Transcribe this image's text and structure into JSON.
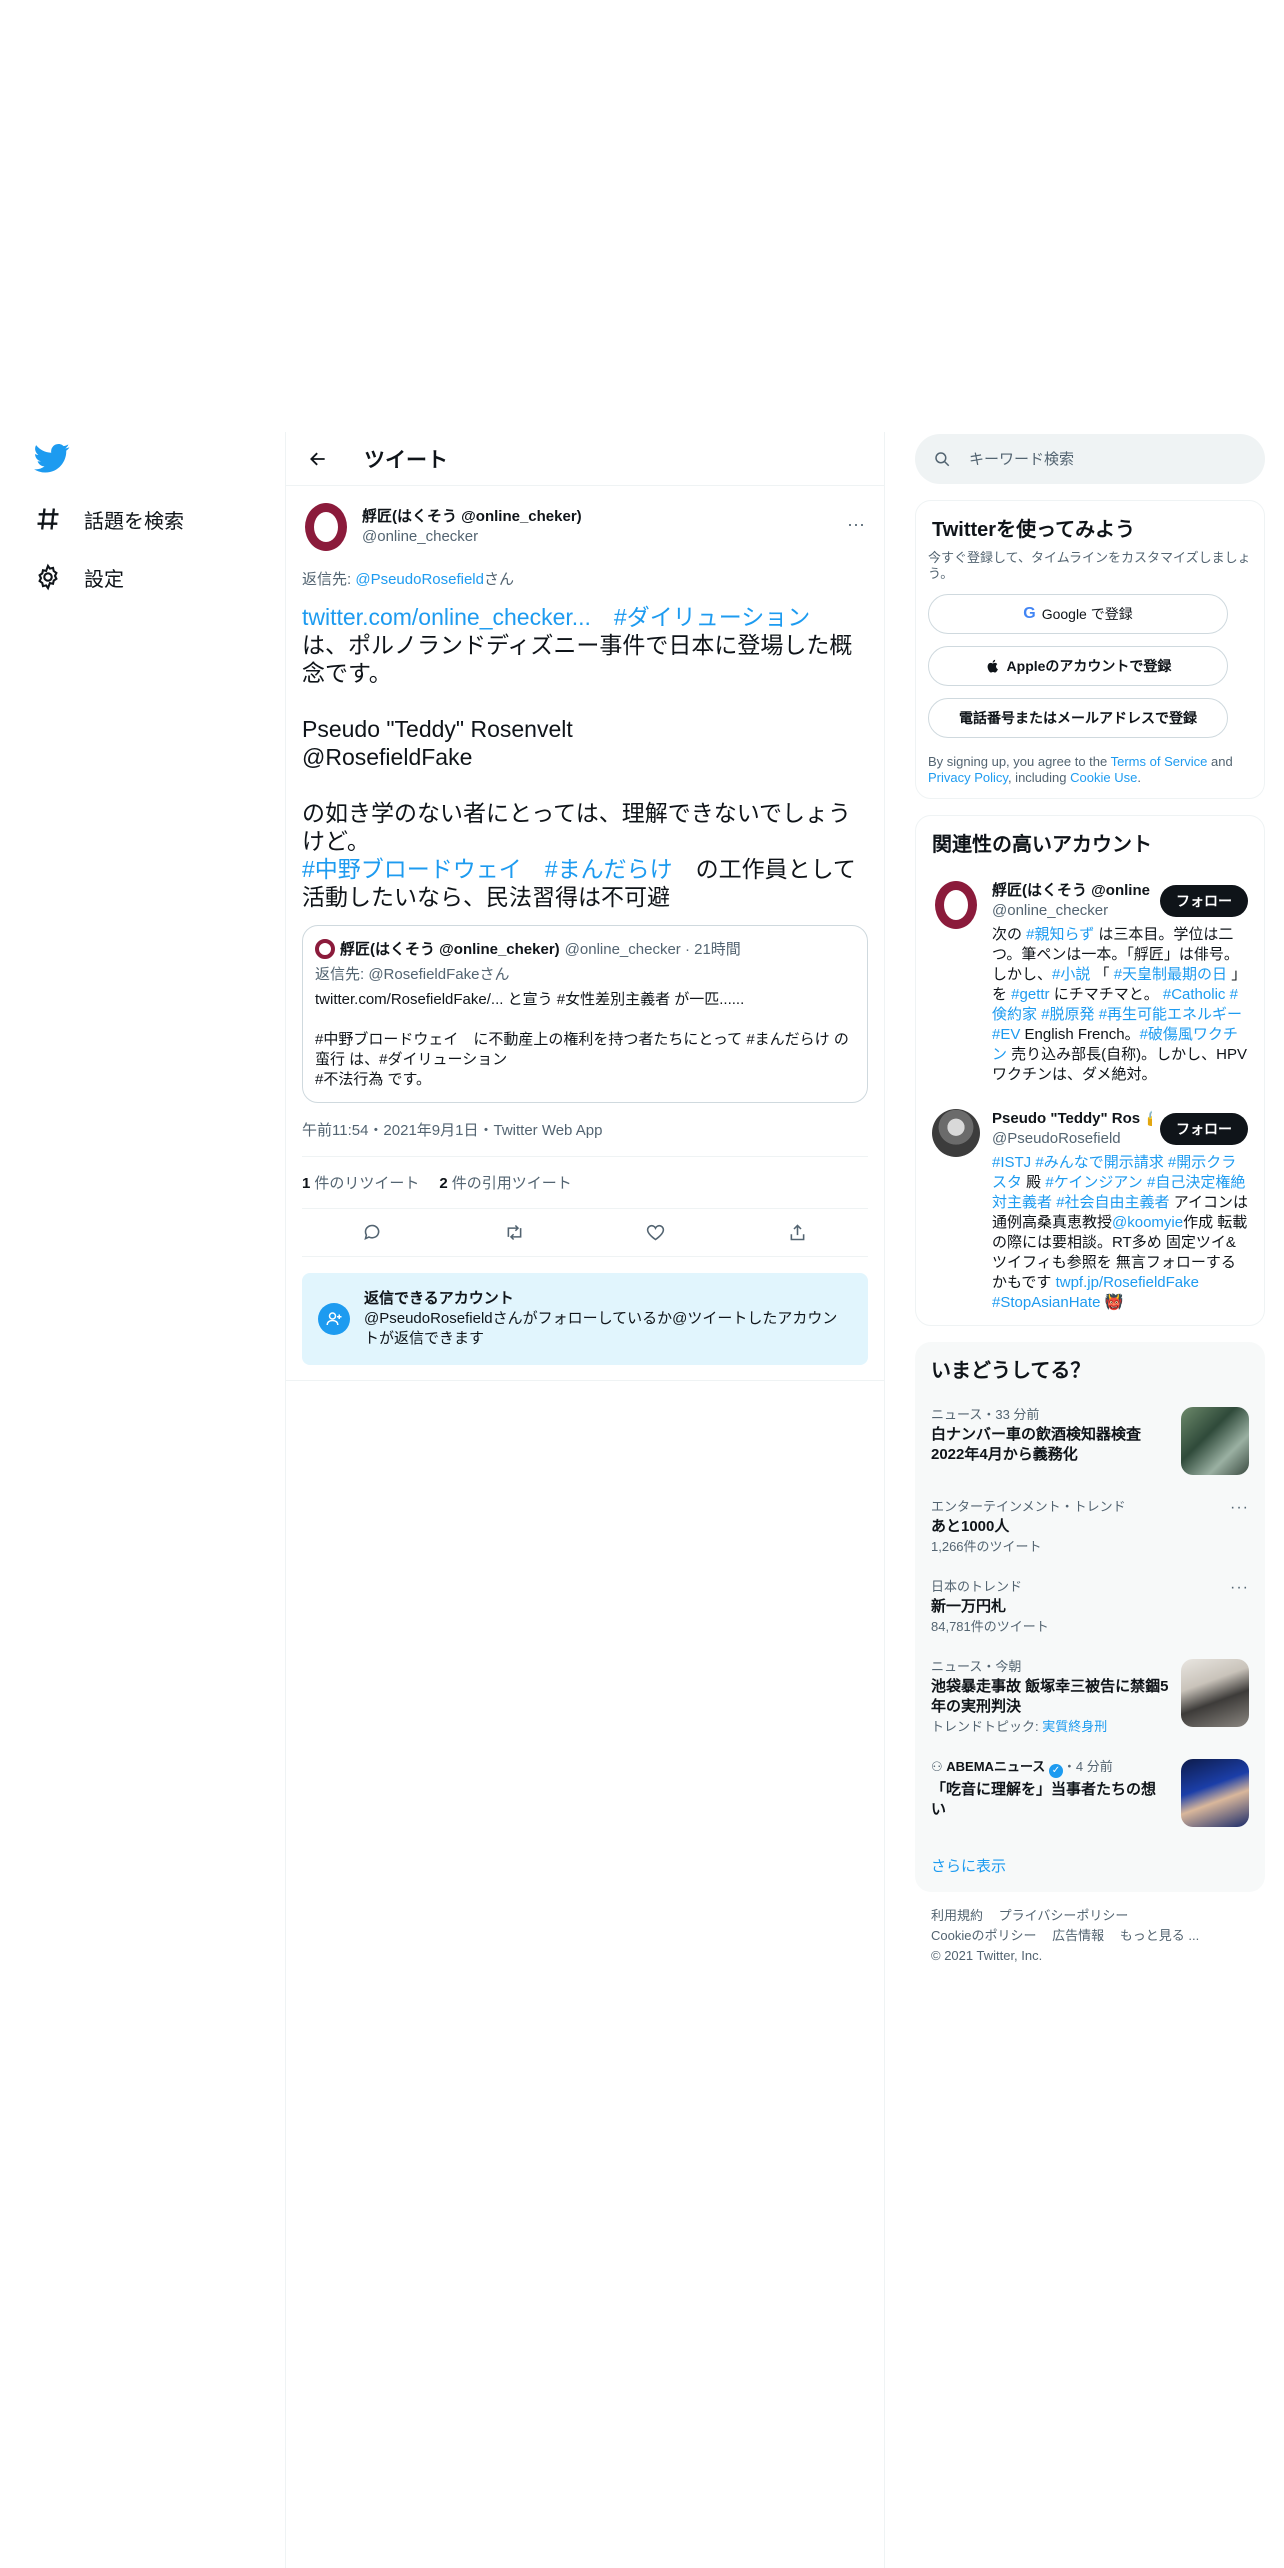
{
  "nav": {
    "items": [
      {
        "label": "話題を検索",
        "icon": "hashtag-icon"
      },
      {
        "label": "設定",
        "icon": "gear-icon"
      }
    ]
  },
  "header": {
    "title": "ツイート"
  },
  "tweet": {
    "display_name": "艀匠(はくそう @online_cheker)",
    "handle": "@online_checker",
    "reply_prefix": "返信先: ",
    "reply_target": "@PseudoRosefield",
    "reply_suffix": "さん",
    "link": "twitter.com/online_checker...",
    "tag1": "#ダイリューション",
    "text1": "は、ポルノランドディズニー事件で日本に登場した概念です。\n\nPseudo \"Teddy\" Rosenvelt\n@RosefieldFake\n\nの如き学のない者にとっては、理解できないでしょうけど。",
    "tag2": "#中野ブロードウェイ",
    "tag3": "#まんだらけ",
    "text2": "の工作員として活動したいなら、民法習得は不可避",
    "quote": {
      "display_name": "艀匠(はくそう @online_cheker)",
      "handle_time": "@online_checker · 21時間",
      "reply": "返信先: @RosefieldFakeさん",
      "body": "twitter.com/RosefieldFake/... と宣う #女性差別主義者 が一匹......\n\n#中野ブロードウェイ　に不動産上の権利を持つ者たちにとって #まんだらけ の蛮行 は、#ダイリューション\n#不法行為 です。"
    },
    "meta": "午前11:54・2021年9月1日・Twitter Web App",
    "retweets_count": "1",
    "retweets_label": "件のリツイート",
    "quotes_count": "2",
    "quotes_label": "件の引用ツイート"
  },
  "reply_box": {
    "title": "返信できるアカウント",
    "desc": "@PseudoRosefieldさんがフォローしているか@ツイートしたアカウントが返信できます"
  },
  "search": {
    "placeholder": "キーワード検索"
  },
  "signup": {
    "title": "Twitterを使ってみよう",
    "subtitle": "今すぐ登録して、タイムラインをカスタマイズしましょう。",
    "google_label": "Google で登録",
    "apple_label": "Appleのアカウントで登録",
    "phone_label": "電話番号またはメールアドレスで登録",
    "terms_prefix": "By signing up, you agree to the ",
    "terms_link": "Terms of Service",
    "terms_and": " and ",
    "privacy_link": "Privacy Policy",
    "terms_including": ", including ",
    "cookie_link": "Cookie Use",
    "terms_end": "."
  },
  "related": {
    "title": "関連性の高いアカウント",
    "accounts": [
      {
        "name": "艀匠(はくそう @online",
        "handle": "@online_checker",
        "follow_label": "フォロー",
        "bio": "次の #親知らず は三本目。学位は二つ。筆ペンは一本。「艀匠」は俳号。しかし、#小説 「 #天皇制最期の日 」を #gettr にチマチマと。 #Catholic #倹約家 #脱原発 #再生可能エネルギー #EV English French。#破傷風ワクチン 売り込み部長(自称)。しかし、HPVワクチンは、ダメ絶対。"
      },
      {
        "name": "Pseudo \"Teddy\" Ros",
        "handle": "@PseudoRosefield",
        "follow_label": "フォロー",
        "bio": "#ISTJ #みんなで開示請求 #開示クラスタ 殿 #ケインジアン #自己決定権絶対主義者 #社会自由主義者 アイコンは通例高桑真恵教授@koomyie作成 転載の際には要相談。RT多め 固定ツイ&ツイフィも参照を 無言フォローするかもです twpf.jp/RosefieldFake #StopAsianHate 👹"
      }
    ]
  },
  "trends": {
    "title": "いまどうしてる？",
    "items": [
      {
        "meta": "ニュース・33 分前",
        "title": "白ナンバー車の飲酒検知器検査 2022年4月から義務化",
        "sub": ""
      },
      {
        "meta": "エンターテインメント・トレンド",
        "title": "あと1000人",
        "sub": "1,266件のツイート"
      },
      {
        "meta": "日本のトレンド",
        "title": "新一万円札",
        "sub": "84,781件のツイート"
      },
      {
        "meta": "ニュース・今朝",
        "title": "池袋暴走事故 飯塚幸三被告に禁錮5年の実刑判決",
        "sub_prefix": "トレンドトピック: ",
        "sub_link": "実質終身刑"
      },
      {
        "meta_source": "ABEMAニュース",
        "meta_time": "・4 分前",
        "title": "「吃音に理解を」当事者たちの想い"
      }
    ],
    "show_more": "さらに表示"
  },
  "footer": {
    "links1": [
      "利用規約",
      "プライバシーポリシー"
    ],
    "links2": [
      "Cookieのポリシー",
      "広告情報",
      "もっと見る ..."
    ],
    "copyright": "© 2021 Twitter, Inc."
  },
  "colors": {
    "accent": "#1d9bf0",
    "brand_maroon": "#8b1b3b",
    "reply_box_bg": "#e1f5fd"
  }
}
